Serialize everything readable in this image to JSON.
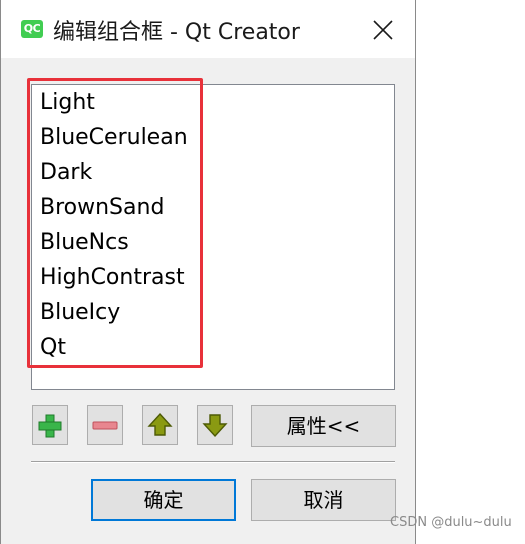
{
  "window": {
    "app_icon_text": "QC",
    "title": "编辑组合框 - Qt Creator"
  },
  "list": {
    "items": [
      "Light",
      "BlueCerulean",
      "Dark",
      "BrownSand",
      "BlueNcs",
      "HighContrast",
      "BlueIcy",
      "Qt"
    ]
  },
  "toolbar": {
    "add_icon": "plus-icon",
    "remove_icon": "minus-icon",
    "move_up_icon": "arrow-up-icon",
    "move_down_icon": "arrow-down-icon",
    "properties_label": "属性<<"
  },
  "buttons": {
    "ok_label": "确定",
    "cancel_label": "取消"
  },
  "watermark": "CSDN @dulu~dulu",
  "colors": {
    "highlight_border": "#e8313a",
    "default_button_border": "#0078d7",
    "add_icon": "#39b54a",
    "remove_icon": "#e8868f",
    "move_icons": "#8a9a12"
  }
}
